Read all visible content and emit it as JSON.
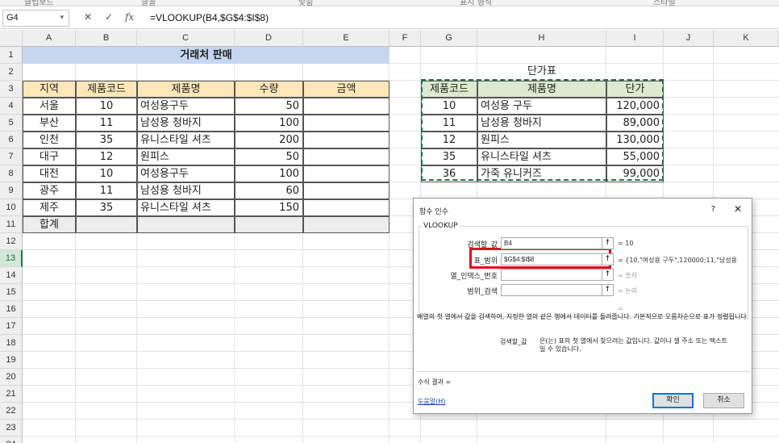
{
  "ribbon": [
    "클립보드",
    "글꼴",
    "맞춤",
    "표시 형식",
    "스타일"
  ],
  "formula_bar": {
    "name_box": "G4",
    "cancel_glyph": "✕",
    "enter_glyph": "✓",
    "fx_glyph": "fx",
    "formula": "=VLOOKUP(B4,$G$4:$I$8)"
  },
  "columns": [
    "A",
    "B",
    "C",
    "D",
    "E",
    "F",
    "G",
    "H",
    "I",
    "J",
    "K"
  ],
  "rows": [
    "1",
    "2",
    "3",
    "4",
    "5",
    "6",
    "7",
    "8",
    "9",
    "10",
    "11",
    "12",
    "13",
    "14",
    "15",
    "16",
    "17",
    "18",
    "19",
    "20",
    "21",
    "22",
    "23",
    "24"
  ],
  "sales": {
    "title": "거래처 판매",
    "headers": [
      "지역",
      "제품코드",
      "제품명",
      "수량",
      "금액"
    ],
    "rows": [
      {
        "region": "서울",
        "code": "10",
        "name": "여성용구두",
        "qty": "50"
      },
      {
        "region": "부산",
        "code": "11",
        "name": "남성용 청바지",
        "qty": "100"
      },
      {
        "region": "인천",
        "code": "35",
        "name": "유니스타일 셔츠",
        "qty": "200"
      },
      {
        "region": "대구",
        "code": "12",
        "name": "원피스",
        "qty": "50"
      },
      {
        "region": "대전",
        "code": "10",
        "name": "여성용구두",
        "qty": "100"
      },
      {
        "region": "광주",
        "code": "11",
        "name": "남성용 청바지",
        "qty": "60"
      },
      {
        "region": "제주",
        "code": "35",
        "name": "유니스타일 셔츠",
        "qty": "150"
      }
    ],
    "total_label": "합계"
  },
  "price_table": {
    "title": "단가표",
    "headers": [
      "제품코드",
      "제품명",
      "단가"
    ],
    "rows": [
      {
        "code": "10",
        "name": "여성용 구두",
        "price": "120,000"
      },
      {
        "code": "11",
        "name": "남성용 청바지",
        "price": "89,000"
      },
      {
        "code": "12",
        "name": "원피스",
        "price": "130,000"
      },
      {
        "code": "35",
        "name": "유니스타일 셔츠",
        "price": "55,000"
      },
      {
        "code": "36",
        "name": "가죽 유니커즈",
        "price": "99,000"
      }
    ]
  },
  "dialog": {
    "title": "함수 인수",
    "help_glyph": "?",
    "close_glyph": "✕",
    "function_name": "VLOOKUP",
    "args": [
      {
        "label": "검색할_값",
        "value": "B4",
        "result": "= 10"
      },
      {
        "label": "표_범위",
        "value": "$G$4:$I$8",
        "result": "= {10,\"여성용 구두\",120000;11,\"남성용"
      },
      {
        "label": "열_인덱스_번호",
        "value": "",
        "result": "= 숫자"
      },
      {
        "label": "범위_검색",
        "value": "",
        "result": "= 논리"
      }
    ],
    "collapse_glyph": "⭡",
    "eq_blank": "=",
    "description": "배열의 첫 열에서 값을 검색하여, 지정한 열의 같은 행에서 데이터를 돌려줍니다. 기본적으로 오름차순으로 표가 정렬됩니다.",
    "arg_label": "검색할_값",
    "arg_description": "은(는) 표의 첫 열에서 찾으려는 값입니다. 값이나 셀 주소 또는 텍스트일 수 있습니다.",
    "result_label": "수식 결과 =",
    "help_link": "도움말(H)",
    "ok": "확인",
    "cancel": "취소"
  }
}
